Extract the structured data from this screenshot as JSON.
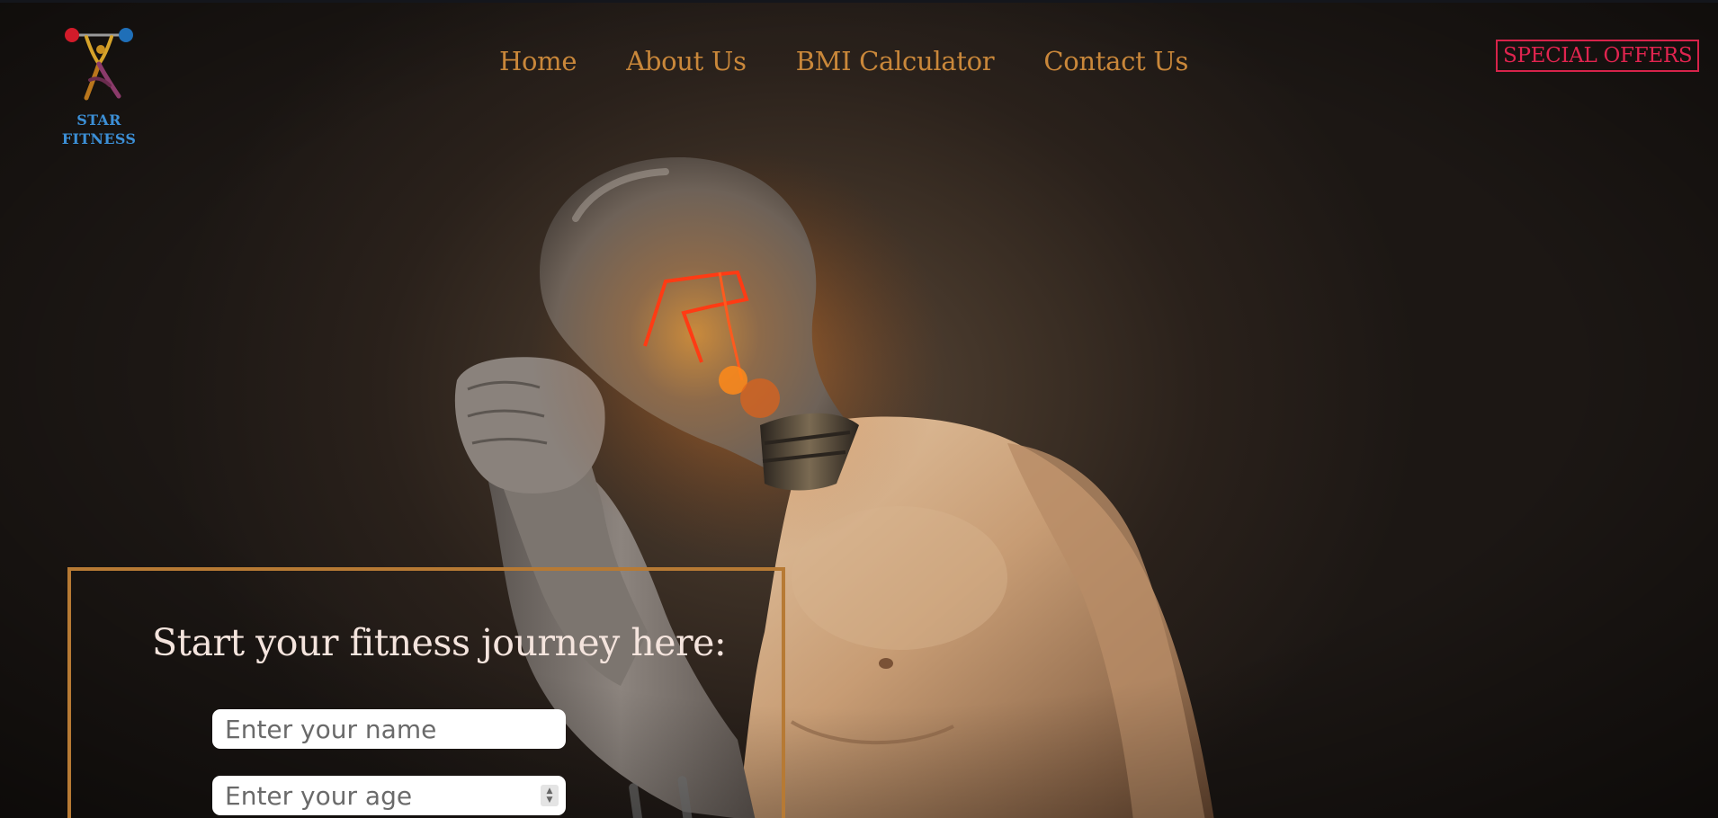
{
  "brand": {
    "logo_line1": "STAR",
    "logo_line2": "FITNESS",
    "logo_icon": "weightlifter-icon",
    "color": "#3c8fd6"
  },
  "nav": {
    "items": [
      {
        "label": "Home"
      },
      {
        "label": "About Us"
      },
      {
        "label": "BMI Calculator"
      },
      {
        "label": "Contact Us"
      }
    ],
    "color": "#c9873a"
  },
  "special_offers": {
    "label": "SPECIAL OFFERS",
    "color": "#e0244f"
  },
  "hero": {
    "image": "lightbulb-head-man-image"
  },
  "form": {
    "title": "Start your fitness journey here:",
    "name_placeholder": "Enter your name",
    "age_placeholder": "Enter your age",
    "border_color": "#b77a34"
  }
}
